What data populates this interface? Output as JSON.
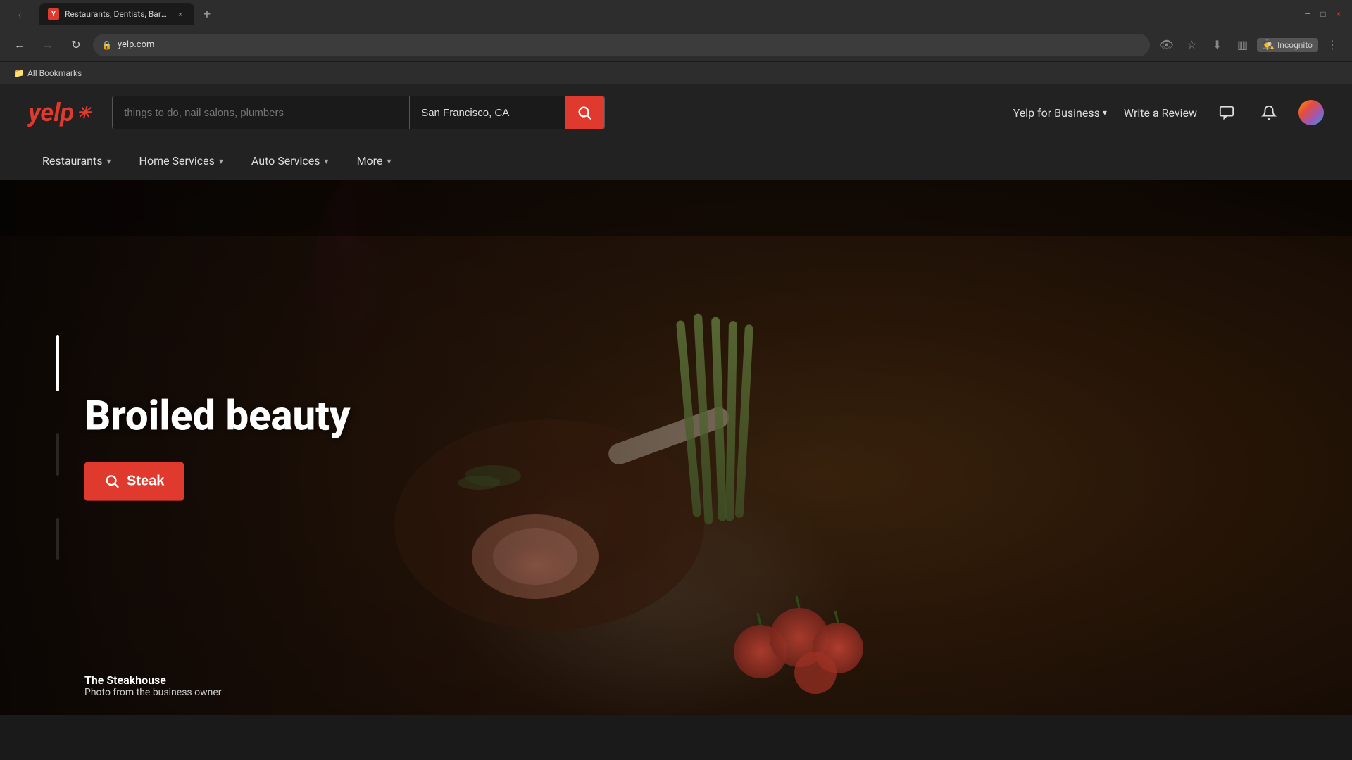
{
  "browser": {
    "tab": {
      "title": "Restaurants, Dentists, Bars, Bea",
      "favicon": "Y",
      "close_label": "×"
    },
    "new_tab_label": "+",
    "address": "yelp.com",
    "window_controls": {
      "minimize": "—",
      "maximize": "□",
      "close": "×"
    },
    "toolbar": {
      "back_icon": "←",
      "forward_icon": "→",
      "reload_icon": "↻",
      "lock_icon": "🔒",
      "star_icon": "☆",
      "download_icon": "↓",
      "sidebar_icon": "▥",
      "incognito_label": "Incognito",
      "more_icon": "⋮"
    },
    "bookmarks": {
      "folder_icon": "📁",
      "label": "All Bookmarks"
    }
  },
  "yelp": {
    "logo_text": "yelp",
    "logo_burst": "✳",
    "search": {
      "what_placeholder": "things to do, nail salons, plumbers",
      "where_value": "San Francisco, CA",
      "button_icon": "🔍"
    },
    "header_links": {
      "yelp_for_business": "Yelp for Business",
      "write_review": "Write a Review"
    },
    "nav": [
      {
        "label": "Restaurants",
        "has_chevron": true
      },
      {
        "label": "Home Services",
        "has_chevron": true
      },
      {
        "label": "Auto Services",
        "has_chevron": true
      },
      {
        "label": "More",
        "has_chevron": true
      }
    ],
    "hero": {
      "title": "Broiled beauty",
      "cta_label": "Steak",
      "cta_icon": "🔍",
      "caption_title": "The Steakhouse",
      "caption_sub": "Photo from the business owner"
    }
  }
}
